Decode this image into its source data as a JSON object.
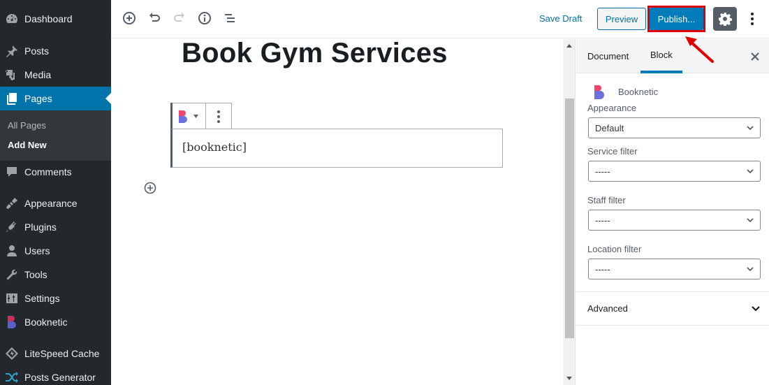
{
  "admin_menu": {
    "items": [
      {
        "label": "Dashboard",
        "icon": "dashboard-icon"
      },
      {
        "label": "Posts",
        "icon": "pushpin-icon"
      },
      {
        "label": "Media",
        "icon": "media-icon"
      },
      {
        "label": "Pages",
        "icon": "pages-icon",
        "active": true
      },
      {
        "label": "Comments",
        "icon": "comment-icon"
      },
      {
        "label": "Appearance",
        "icon": "paintbrush-icon"
      },
      {
        "label": "Plugins",
        "icon": "plugin-icon"
      },
      {
        "label": "Users",
        "icon": "user-icon"
      },
      {
        "label": "Tools",
        "icon": "wrench-icon"
      },
      {
        "label": "Settings",
        "icon": "settings-sliders-icon"
      },
      {
        "label": "Booknetic",
        "icon": "booknetic-logo-icon"
      },
      {
        "label": "LiteSpeed Cache",
        "icon": "litespeed-icon"
      },
      {
        "label": "Posts Generator",
        "icon": "shuffle-icon"
      }
    ],
    "submenu": [
      {
        "label": "All Pages"
      },
      {
        "label": "Add New",
        "current": true
      }
    ]
  },
  "toolbar": {
    "icons": [
      "add-block-icon",
      "undo-icon",
      "redo-icon",
      "info-icon",
      "outline-icon"
    ],
    "save_draft": "Save Draft",
    "preview": "Preview",
    "publish": "Publish...",
    "settings_icon": "gear-icon",
    "more_icon": "more-vertical-icon"
  },
  "editor": {
    "title": "Book Gym Services",
    "block": {
      "content": "[booknetic]",
      "switcher_icon": "booknetic-logo-icon"
    }
  },
  "sidebar": {
    "tabs": [
      {
        "label": "Document"
      },
      {
        "label": "Block",
        "active": true
      }
    ],
    "block_name": "Booknetic",
    "fields": [
      {
        "label": "Appearance",
        "value": "Default"
      },
      {
        "label": "Service filter",
        "value": "-----"
      },
      {
        "label": "Staff filter",
        "value": "-----"
      },
      {
        "label": "Location filter",
        "value": "-----"
      }
    ],
    "advanced_label": "Advanced"
  },
  "colors": {
    "admin_bg": "#23282d",
    "admin_active": "#0073aa",
    "primary": "#007cba",
    "highlight_box": "#e00000",
    "booknetic_pink": "#f0446b",
    "booknetic_purple": "#6c70dc"
  }
}
